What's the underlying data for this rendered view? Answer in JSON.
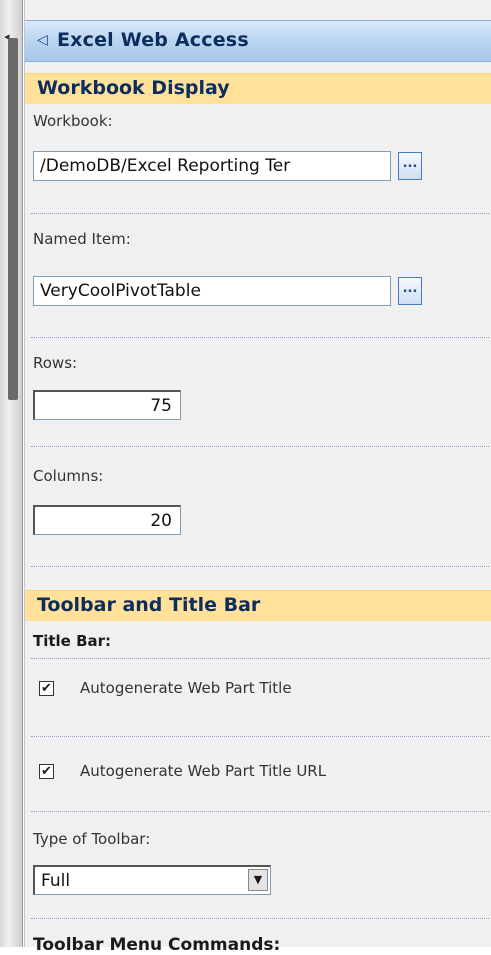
{
  "panel": {
    "title": "Excel Web Access",
    "collapse_icon": "collapse-arrow-icon"
  },
  "workbook_display": {
    "header": "Workbook Display",
    "workbook_label": "Workbook:",
    "workbook_value": "/DemoDB/Excel Reporting Ter",
    "workbook_browse": "...",
    "named_item_label": "Named Item:",
    "named_item_value": "VeryCoolPivotTable",
    "named_item_browse": "...",
    "rows_label": "Rows:",
    "rows_value": "75",
    "columns_label": "Columns:",
    "columns_value": "20"
  },
  "toolbar_title_bar": {
    "header": "Toolbar and Title Bar",
    "title_bar_label": "Title Bar:",
    "autogen_title_label": "Autogenerate Web Part Title",
    "autogen_title_checked": true,
    "autogen_title_check": "✔",
    "autogen_url_label": "Autogenerate Web Part Title URL",
    "autogen_url_checked": true,
    "autogen_url_check": "✔",
    "toolbar_type_label": "Type of Toolbar:",
    "toolbar_type_value": "Full",
    "toolbar_menu_label": "Toolbar Menu Commands:"
  },
  "colors": {
    "title_bar": "#bcd6f1",
    "section_header": "#ffe19a",
    "panel_bg": "#f0f0f0",
    "title_text": "#0d2d5e"
  }
}
